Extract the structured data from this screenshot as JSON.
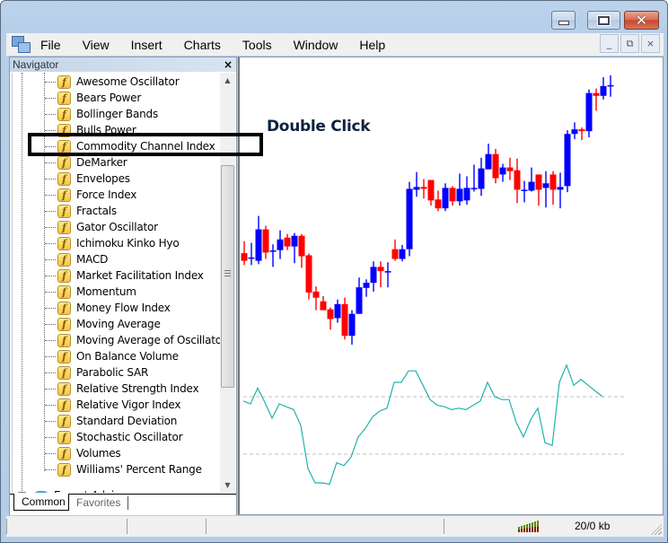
{
  "window": {
    "controls": {
      "minimize": "minimize",
      "maximize": "maximize",
      "close": "close"
    }
  },
  "menubar": {
    "items": [
      "File",
      "View",
      "Insert",
      "Charts",
      "Tools",
      "Window",
      "Help"
    ],
    "mdi_controls": {
      "minimize": "_",
      "restore": "⧉",
      "close": "×"
    }
  },
  "navigator": {
    "title": "Navigator",
    "close_glyph": "×",
    "indicators": [
      "Awesome Oscillator",
      "Bears Power",
      "Bollinger Bands",
      "Bulls Power",
      "Commodity Channel Index",
      "DeMarker",
      "Envelopes",
      "Force Index",
      "Fractals",
      "Gator Oscillator",
      "Ichimoku Kinko Hyo",
      "MACD",
      "Market Facilitation Index",
      "Momentum",
      "Money Flow Index",
      "Moving Average",
      "Moving Average of Oscillator",
      "On Balance Volume",
      "Parabolic SAR",
      "Relative Strength Index",
      "Relative Vigor Index",
      "Standard Deviation",
      "Stochastic Oscillator",
      "Volumes",
      "Williams' Percent Range"
    ],
    "indicator_icon_glyph": "f",
    "expert_advisors": {
      "label": "Expert Advisors",
      "expand_glyph": "+"
    },
    "tabs": [
      {
        "label": "Common",
        "active": true
      },
      {
        "label": "Favorites",
        "active": false
      }
    ],
    "highlighted_item": "Commodity Channel Index"
  },
  "annotation": {
    "text": "Double Click"
  },
  "statusbar": {
    "traffic": "20/0 kb"
  },
  "colors": {
    "bull": "#0000ff",
    "bear": "#ff0000",
    "cci_line": "#20b2aa",
    "level_line": "#c0c0c0"
  },
  "chart_data": [
    {
      "type": "candlestick",
      "title": "",
      "note": "Price values in relative units (higher = higher price); read from screen, no axis labels visible",
      "ylim": [
        0,
        100
      ],
      "candles": [
        {
          "o": 56.5,
          "c": 54.0,
          "h": 60.4,
          "l": 52.6
        },
        {
          "o": 55.1,
          "c": 55.1,
          "h": 59.9,
          "l": 52.6
        },
        {
          "o": 54.0,
          "c": 64.3,
          "h": 68.7,
          "l": 52.9
        },
        {
          "o": 64.3,
          "c": 56.7,
          "h": 65.5,
          "l": 54.6
        },
        {
          "o": 57.0,
          "c": 57.4,
          "h": 59.4,
          "l": 52.0
        },
        {
          "o": 57.5,
          "c": 61.0,
          "h": 64.0,
          "l": 54.6
        },
        {
          "o": 61.6,
          "c": 58.7,
          "h": 62.8,
          "l": 57.5
        },
        {
          "o": 58.7,
          "c": 62.2,
          "h": 63.1,
          "l": 53.2
        },
        {
          "o": 62.2,
          "c": 55.5,
          "h": 62.8,
          "l": 51.7
        },
        {
          "o": 55.8,
          "c": 43.6,
          "h": 56.4,
          "l": 41.3
        },
        {
          "o": 43.9,
          "c": 41.9,
          "h": 45.6,
          "l": 37.8
        },
        {
          "o": 40.7,
          "c": 37.8,
          "h": 42.4,
          "l": 38.7
        },
        {
          "o": 38.1,
          "c": 34.9,
          "h": 38.7,
          "l": 31.4
        },
        {
          "o": 35.2,
          "c": 39.8,
          "h": 41.3,
          "l": 33.7
        },
        {
          "o": 39.8,
          "c": 29.4,
          "h": 41.9,
          "l": 28.2
        },
        {
          "o": 29.4,
          "c": 36.6,
          "h": 37.8,
          "l": 26.5
        },
        {
          "o": 36.6,
          "c": 45.3,
          "h": 48.5,
          "l": 36.6
        },
        {
          "o": 45.1,
          "c": 46.8,
          "h": 47.9,
          "l": 42.2
        },
        {
          "o": 46.8,
          "c": 52.0,
          "h": 53.8,
          "l": 43.9
        },
        {
          "o": 52.0,
          "c": 50.6,
          "h": 53.8,
          "l": 45.3
        },
        {
          "o": 50.6,
          "c": 50.6,
          "h": 53.5,
          "l": 45.3
        },
        {
          "o": 57.8,
          "c": 54.6,
          "h": 61.0,
          "l": 54.0
        },
        {
          "o": 54.6,
          "c": 57.8,
          "h": 59.2,
          "l": 53.8
        },
        {
          "o": 57.8,
          "c": 77.6,
          "h": 79.9,
          "l": 55.5
        },
        {
          "o": 77.3,
          "c": 78.2,
          "h": 83.1,
          "l": 75.0
        },
        {
          "o": 78.2,
          "c": 77.6,
          "h": 80.8,
          "l": 74.4
        },
        {
          "o": 80.5,
          "c": 73.8,
          "h": 80.5,
          "l": 72.1
        },
        {
          "o": 74.1,
          "c": 71.2,
          "h": 77.0,
          "l": 70.3
        },
        {
          "o": 71.2,
          "c": 77.9,
          "h": 79.4,
          "l": 70.3
        },
        {
          "o": 77.9,
          "c": 73.5,
          "h": 78.5,
          "l": 72.1
        },
        {
          "o": 73.5,
          "c": 77.6,
          "h": 82.6,
          "l": 72.1
        },
        {
          "o": 73.8,
          "c": 77.9,
          "h": 81.7,
          "l": 72.4
        },
        {
          "o": 77.9,
          "c": 77.9,
          "h": 85.5,
          "l": 76.7
        },
        {
          "o": 77.6,
          "c": 84.3,
          "h": 87.8,
          "l": 75.3
        },
        {
          "o": 84.0,
          "c": 89.0,
          "h": 92.4,
          "l": 84.0
        },
        {
          "o": 89.0,
          "c": 81.1,
          "h": 90.7,
          "l": 79.4
        },
        {
          "o": 82.3,
          "c": 84.6,
          "h": 85.8,
          "l": 79.9
        },
        {
          "o": 84.6,
          "c": 83.4,
          "h": 87.8,
          "l": 80.5
        },
        {
          "o": 83.7,
          "c": 77.3,
          "h": 87.5,
          "l": 72.9
        },
        {
          "o": 77.3,
          "c": 77.3,
          "h": 80.2,
          "l": 73.2
        },
        {
          "o": 77.0,
          "c": 79.9,
          "h": 84.6,
          "l": 76.7
        },
        {
          "o": 82.3,
          "c": 77.3,
          "h": 82.3,
          "l": 72.1
        },
        {
          "o": 77.9,
          "c": 79.4,
          "h": 83.4,
          "l": 71.5
        },
        {
          "o": 82.3,
          "c": 77.3,
          "h": 83.4,
          "l": 72.4
        },
        {
          "o": 77.3,
          "c": 78.2,
          "h": 82.9,
          "l": 71.2
        },
        {
          "o": 78.5,
          "c": 95.6,
          "h": 96.8,
          "l": 76.5
        },
        {
          "o": 95.6,
          "c": 97.1,
          "h": 99.4,
          "l": 93.9
        },
        {
          "o": 97.1,
          "c": 96.5,
          "h": 97.7,
          "l": 93.6
        },
        {
          "o": 96.5,
          "c": 109.0,
          "h": 110.2,
          "l": 94.5
        },
        {
          "o": 109.0,
          "c": 108.1,
          "h": 110.5,
          "l": 103.2
        },
        {
          "o": 108.1,
          "c": 111.3,
          "h": 114.2,
          "l": 106.9
        },
        {
          "o": 111.3,
          "c": 111.6,
          "h": 114.8,
          "l": 107.8
        }
      ]
    },
    {
      "type": "line",
      "title": "Commodity Channel Index",
      "levels": [
        100,
        -100
      ],
      "ylim": [
        -250,
        250
      ],
      "values": [
        85,
        75,
        130,
        80,
        25,
        75,
        65,
        55,
        0,
        -150,
        -200,
        -200,
        -205,
        -130,
        -140,
        -110,
        -40,
        -10,
        30,
        50,
        60,
        150,
        150,
        190,
        190,
        140,
        90,
        70,
        65,
        55,
        60,
        55,
        70,
        85,
        150,
        100,
        90,
        90,
        10,
        -40,
        20,
        60,
        -60,
        -70,
        150,
        210,
        140,
        160,
        140,
        120,
        100
      ]
    }
  ]
}
